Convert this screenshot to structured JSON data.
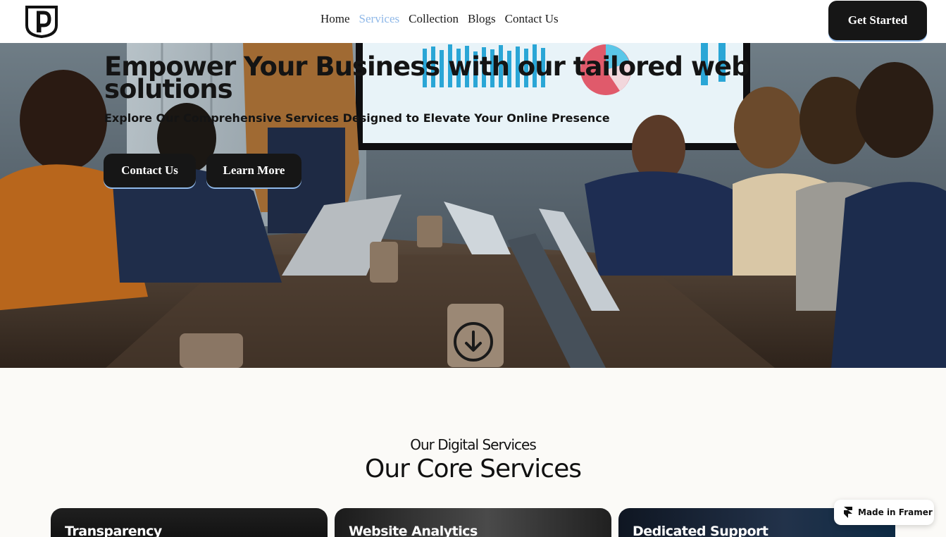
{
  "nav": {
    "links": [
      {
        "label": "Home",
        "active": false
      },
      {
        "label": "Services",
        "active": true
      },
      {
        "label": "Collection",
        "active": false
      },
      {
        "label": "Blogs",
        "active": false
      },
      {
        "label": "Contact Us",
        "active": false
      }
    ],
    "cta_label": "Get Started",
    "active_color": "#8fb8e8"
  },
  "hero": {
    "title": "Empower Your Business with our tailored web solutions",
    "subtitle": "Explore Our Comprehensive Services Designed to Elevate Your Online Presence",
    "contact_label": "Contact Us",
    "learn_label": "Learn More"
  },
  "services": {
    "eyebrow": "Our Digital Services",
    "title": "Our Core Services",
    "cards": [
      {
        "title": "Transparency"
      },
      {
        "title": "Website Analytics"
      },
      {
        "title": "Dedicated Support"
      }
    ]
  },
  "badge": {
    "label": "Made in Framer"
  }
}
